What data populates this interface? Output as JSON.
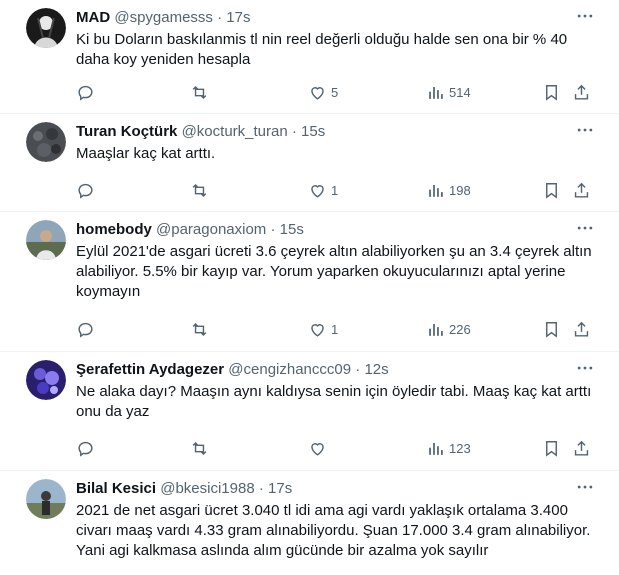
{
  "tweets": [
    {
      "name": "MAD",
      "handle": "@spygamesss",
      "separator": "·",
      "time": "17s",
      "text": "Ki bu Doların baskılanmis tl nin reel değerli olduğu halde sen ona bir % 40 daha koy yeniden hesapla",
      "replies": "",
      "retweets": "",
      "likes": "5",
      "views": "514"
    },
    {
      "name": "Turan Koçtürk",
      "handle": "@kocturk_turan",
      "separator": "·",
      "time": "15s",
      "text": "Maaşlar kaç kat arttı.",
      "replies": "",
      "retweets": "",
      "likes": "1",
      "views": "198"
    },
    {
      "name": "homebody",
      "handle": "@paragonaxiom",
      "separator": "·",
      "time": "15s",
      "text": "Eylül 2021'de asgari ücreti 3.6 çeyrek altın alabiliyorken şu an 3.4 çeyrek altın alabiliyor. 5.5% bir kayıp var. Yorum yaparken okuyucularınızı aptal yerine koymayın",
      "replies": "",
      "retweets": "",
      "likes": "1",
      "views": "226"
    },
    {
      "name": "Şerafettin Aydagezer",
      "handle": "@cengizhanccc09",
      "separator": "·",
      "time": "12s",
      "text": "Ne alaka dayı? Maaşın aynı kaldıysa senin için öyledir tabi. Maaş kaç kat arttı onu da yaz",
      "replies": "",
      "retweets": "",
      "likes": "",
      "views": "123"
    },
    {
      "name": "Bilal Kesici",
      "handle": "@bkesici1988",
      "separator": "·",
      "time": "17s",
      "text": "2021 de net asgari ücret 3.040 tl idi ama agi vardı yaklaşık ortalama 3.400 civarı maaş vardı 4.33 gram alınabiliyordu. Şuan 17.000 3.4 gram alınabiliyor. Yani agi kalkmasa aslında alım gücünde bir azalma yok sayılır",
      "replies": "",
      "retweets": "",
      "likes": "",
      "views": ""
    }
  ],
  "icons": {
    "reply": "reply-icon",
    "retweet": "retweet-icon",
    "like": "like-icon",
    "views": "views-icon",
    "bookmark": "bookmark-icon",
    "share": "share-icon",
    "more": "more-icon"
  },
  "colors": {
    "text": "#0f1419",
    "secondary": "#536471",
    "divider": "#eff3f4"
  }
}
